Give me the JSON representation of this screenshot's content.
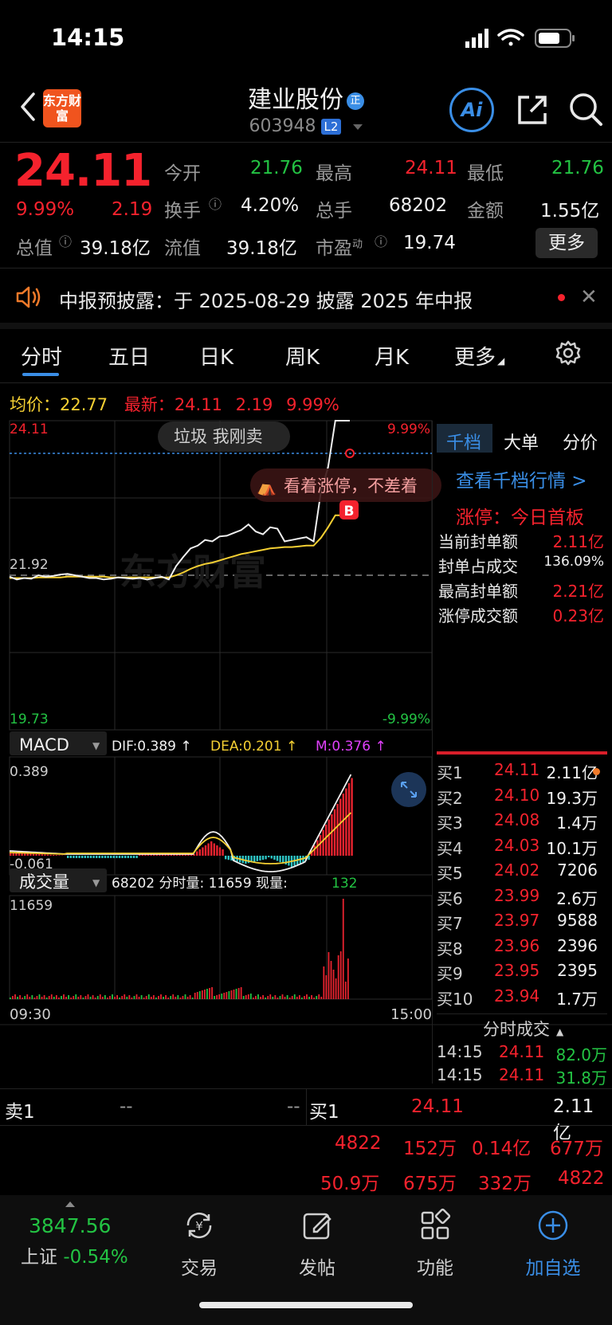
{
  "status_bar": {
    "time": "14:15"
  },
  "header": {
    "logo_text": "东方财富",
    "stock_name": "建业股份",
    "name_tag": "正",
    "stock_code": "603948",
    "level_badge": "L2",
    "ai_label": "Ai"
  },
  "quote": {
    "price": "24.11",
    "change_pct": "9.99%",
    "change": "2.19",
    "fields": [
      {
        "label": "今开",
        "value": "21.76",
        "color": "green"
      },
      {
        "label": "最高",
        "value": "24.11",
        "color": "red"
      },
      {
        "label": "最低",
        "value": "21.76",
        "color": "green"
      },
      {
        "label": "换手",
        "value": "4.20%",
        "color": "white"
      },
      {
        "label": "总手",
        "value": "68202",
        "color": "white"
      },
      {
        "label": "金额",
        "value": "1.55亿",
        "color": "white"
      },
      {
        "label": "总值",
        "value": "39.18亿",
        "color": "white"
      },
      {
        "label": "流值",
        "value": "39.18亿",
        "color": "white"
      },
      {
        "label": "市盈",
        "sup": "动",
        "value": "19.74",
        "color": "white"
      }
    ],
    "more_label": "更多"
  },
  "notice": {
    "text": "中报预披露：于 2025-08-29 披露 2025 年中报",
    "close": "✕"
  },
  "tabs": [
    "分时",
    "五日",
    "日K",
    "周K",
    "月K",
    "更多"
  ],
  "info_row": {
    "avg_label": "均价：",
    "avg_value": "22.77",
    "latest_label": "最新：",
    "latest_value": "24.11",
    "latest_change": "2.19",
    "latest_pct": "9.99%"
  },
  "chart_data": [
    {
      "type": "line",
      "name": "分时",
      "y_high_label": "24.11",
      "y_mid_label": "21.92",
      "y_low_label": "19.73",
      "pct_high_label": "9.99%",
      "pct_low_label": "-9.99%",
      "ylim": [
        19.73,
        24.11
      ],
      "x_start_label": "09:30",
      "x_end_label": "15:00",
      "series": [
        {
          "name": "价格",
          "values": [
            21.9,
            21.86,
            21.88,
            21.87,
            21.92,
            21.9,
            21.91,
            21.93,
            21.94,
            21.92,
            21.9,
            21.88,
            21.88,
            21.86,
            21.87,
            21.89,
            21.88,
            21.87,
            21.88,
            21.86,
            21.88,
            21.9,
            21.86,
            22.05,
            22.18,
            22.3,
            22.34,
            22.42,
            22.4,
            22.47,
            22.48,
            22.52,
            22.56,
            22.64,
            22.54,
            22.5,
            22.6,
            22.58,
            22.4,
            22.42,
            22.44,
            22.46,
            22.4,
            23.1,
            23.45,
            24.11,
            24.11,
            24.11
          ]
        },
        {
          "name": "均价",
          "values": [
            21.88,
            21.88,
            21.88,
            21.88,
            21.89,
            21.89,
            21.89,
            21.89,
            21.9,
            21.9,
            21.9,
            21.9,
            21.9,
            21.9,
            21.89,
            21.89,
            21.89,
            21.89,
            21.89,
            21.89,
            21.89,
            21.89,
            21.89,
            21.92,
            21.96,
            22.01,
            22.05,
            22.08,
            22.1,
            22.13,
            22.16,
            22.19,
            22.22,
            22.24,
            22.26,
            22.28,
            22.3,
            22.31,
            22.32,
            22.32,
            22.33,
            22.34,
            22.34,
            22.45,
            22.6,
            22.77,
            22.77,
            22.77
          ]
        }
      ]
    },
    {
      "type": "bar",
      "name": "MACD",
      "dif": "DIF:0.389 ↑",
      "dea": "DEA:0.201 ↑",
      "m": "M:0.376 ↑",
      "y_high_label": "0.389",
      "y_low_label": "-0.061"
    },
    {
      "type": "bar",
      "name": "成交量",
      "summary": "68202 分时量: 11659 现量:",
      "current": "132",
      "y_high_label": "11659"
    }
  ],
  "overlays": {
    "comment_bubble": "垃圾 我刚卖",
    "comment_bubble2": "看着涨停，不差着",
    "buy_marker": "B"
  },
  "right_panel": {
    "tabs": [
      "千档",
      "大单",
      "分价"
    ],
    "link": "查看千档行情 >",
    "zt_title": "涨停：今日首板",
    "rows": [
      {
        "label": "当前封单额",
        "value": "2.11亿"
      },
      {
        "label": "封单占成交",
        "value": "136.09%"
      },
      {
        "label": "最高封单额",
        "value": "2.21亿"
      },
      {
        "label": "涨停成交额",
        "value": "0.23亿"
      }
    ],
    "bids": [
      {
        "name": "买1",
        "price": "24.11",
        "qty": "2.11亿"
      },
      {
        "name": "买2",
        "price": "24.10",
        "qty": "19.3万"
      },
      {
        "name": "买3",
        "price": "24.08",
        "qty": "1.4万"
      },
      {
        "name": "买4",
        "price": "24.03",
        "qty": "10.1万"
      },
      {
        "name": "买5",
        "price": "24.02",
        "qty": "7206"
      },
      {
        "name": "买6",
        "price": "23.99",
        "qty": "2.6万"
      },
      {
        "name": "买7",
        "price": "23.97",
        "qty": "9588"
      },
      {
        "name": "买8",
        "price": "23.96",
        "qty": "2396"
      },
      {
        "name": "买9",
        "price": "23.95",
        "qty": "2395"
      },
      {
        "name": "买10",
        "price": "23.94",
        "qty": "1.7万"
      }
    ],
    "ticks_title": "分时成交",
    "ticks": [
      {
        "time": "14:15",
        "price": "24.11",
        "qty": "82.0万"
      },
      {
        "time": "14:15",
        "price": "24.11",
        "qty": "31.8万"
      }
    ]
  },
  "bottom_quote": {
    "sell1_label": "卖1",
    "sell1_price": "--",
    "sell1_qty": "--",
    "buy1_label": "买1",
    "buy1_price": "24.11",
    "buy1_qty": "2.11亿",
    "row2": [
      "4822",
      "152万",
      "0.14亿",
      "677万"
    ],
    "row3": [
      "50.9万",
      "675万",
      "332万",
      "4822"
    ]
  },
  "bottom_nav": {
    "index_value": "3847.56",
    "index_name": "上证",
    "index_pct": "-0.54%",
    "items": [
      "交易",
      "发帖",
      "功能",
      "加自选"
    ]
  }
}
